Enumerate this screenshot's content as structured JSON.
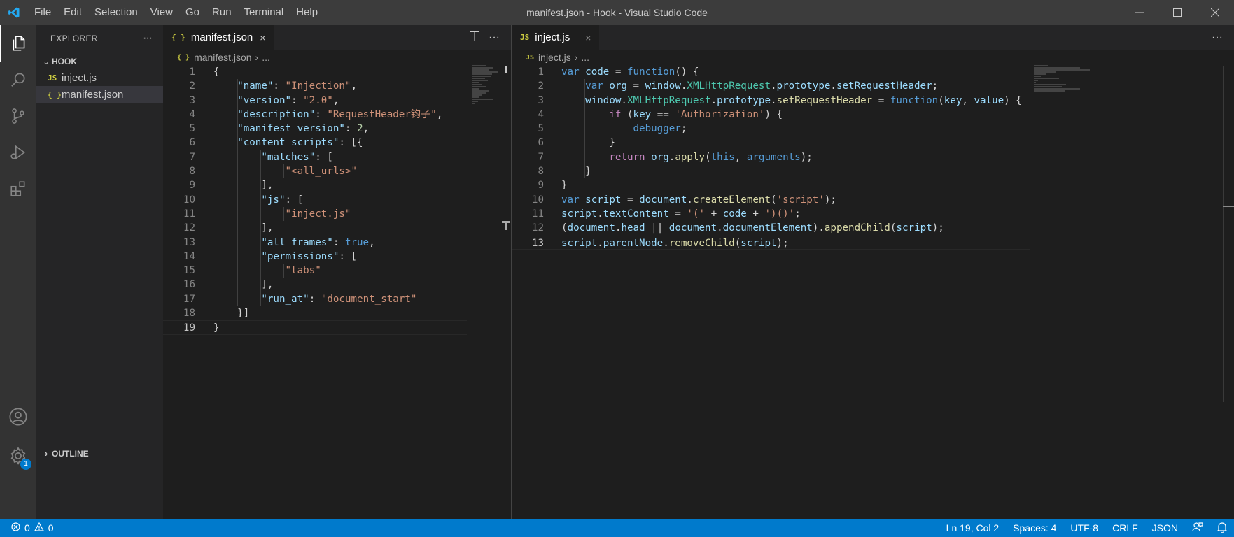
{
  "window": {
    "title": "manifest.json - Hook - Visual Studio Code",
    "menu": [
      "File",
      "Edit",
      "Selection",
      "View",
      "Go",
      "Run",
      "Terminal",
      "Help"
    ]
  },
  "activity_bar": {
    "items": [
      "explorer-icon",
      "search-icon",
      "source-control-icon",
      "run-debug-icon",
      "extensions-icon"
    ],
    "bottom": [
      "account-icon",
      "settings-gear-icon"
    ],
    "settings_badge": "1"
  },
  "sidebar": {
    "title": "EXPLORER",
    "more": "···",
    "folder": "HOOK",
    "files": [
      {
        "icon": "JS",
        "name": "inject.js"
      },
      {
        "icon": "{ }",
        "name": "manifest.json"
      }
    ],
    "outline": "OUTLINE"
  },
  "editor_left": {
    "tab": {
      "icon": "{ }",
      "label": "manifest.json",
      "close": "×"
    },
    "breadcrumb": {
      "icon": "{ }",
      "file": "manifest.json",
      "sep": "›",
      "more": "..."
    },
    "current_line": 19
  },
  "editor_right": {
    "tab": {
      "icon": "JS",
      "label": "inject.js",
      "close": "×"
    },
    "breadcrumb": {
      "icon": "JS",
      "file": "inject.js",
      "sep": "›",
      "more": "..."
    },
    "current_line": 13
  },
  "status_bar": {
    "errors": "0",
    "warnings": "0",
    "position": "Ln 19, Col 2",
    "spaces": "Spaces: 4",
    "encoding": "UTF-8",
    "eol": "CRLF",
    "language": "JSON"
  },
  "colors": {
    "statusbar": "#007acc",
    "titlebar": "#3c3c3c",
    "activitybar": "#333333",
    "sidebar": "#252526",
    "editor": "#1e1e1e"
  }
}
